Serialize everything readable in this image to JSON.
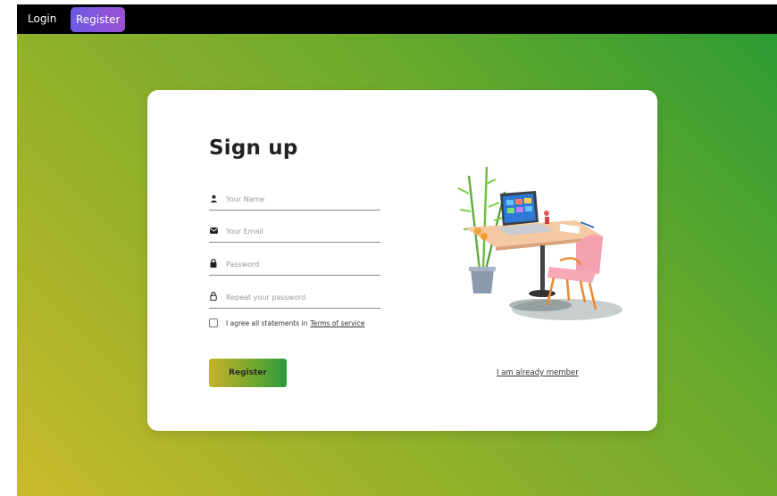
{
  "nav": {
    "login_label": "Login",
    "register_label": "Register"
  },
  "form": {
    "title": "Sign up",
    "fields": [
      {
        "placeholder": "Your Name",
        "icon": "person-icon"
      },
      {
        "placeholder": "Your Email",
        "icon": "mail-icon"
      },
      {
        "placeholder": "Password",
        "icon": "lock-icon"
      },
      {
        "placeholder": "Repeat your password",
        "icon": "lock-outline-icon"
      }
    ],
    "agree_text": "I agree all statements in",
    "terms_link": "Terms of service",
    "agree_checked": false,
    "register_button": "Register",
    "member_link": "I am already member"
  },
  "colors": {
    "nav_background": "#000000",
    "accent_gradient_start": "#6b5be4",
    "accent_gradient_end": "#9b4fd2",
    "page_gradient_start": "#289a34",
    "page_gradient_end": "#c9ba2a",
    "top_tab": "#d5296f"
  },
  "illustration": {
    "icon": "desk-workspace-illustration"
  }
}
